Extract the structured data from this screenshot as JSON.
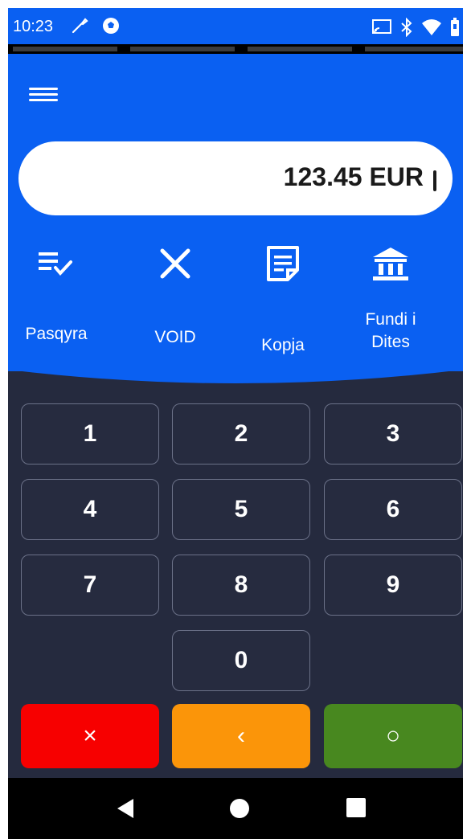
{
  "status": {
    "time": "10:23",
    "icons": [
      "wrench-icon",
      "soccer-ball-icon",
      "cast-icon",
      "bluetooth-icon",
      "wifi-icon",
      "battery-icon"
    ]
  },
  "header": {
    "menu_icon": "hamburger-menu-icon",
    "amount": "123.45 EUR",
    "actions": [
      {
        "label": "Pasqyra",
        "icon": "list-check-icon"
      },
      {
        "label": "VOID",
        "icon": "close-icon"
      },
      {
        "label": "Kopja",
        "icon": "document-icon"
      },
      {
        "label": "Fundi i\nDites",
        "icon": "bank-icon"
      }
    ]
  },
  "keypad": {
    "keys": [
      "1",
      "2",
      "3",
      "4",
      "5",
      "6",
      "7",
      "8",
      "9",
      "0"
    ],
    "cancel": {
      "label": "×",
      "color": "#f70000"
    },
    "back": {
      "label": "‹",
      "color": "#fb9509"
    },
    "ok": {
      "label": "○",
      "color": "#48881f"
    }
  },
  "colors": {
    "accent_blue": "#0a60f2",
    "keypad_background": "#252a3e",
    "key_border": "#6b7188"
  },
  "navbar": {
    "icons": [
      "back-triangle-icon",
      "home-circle-icon",
      "recents-square-icon"
    ]
  }
}
